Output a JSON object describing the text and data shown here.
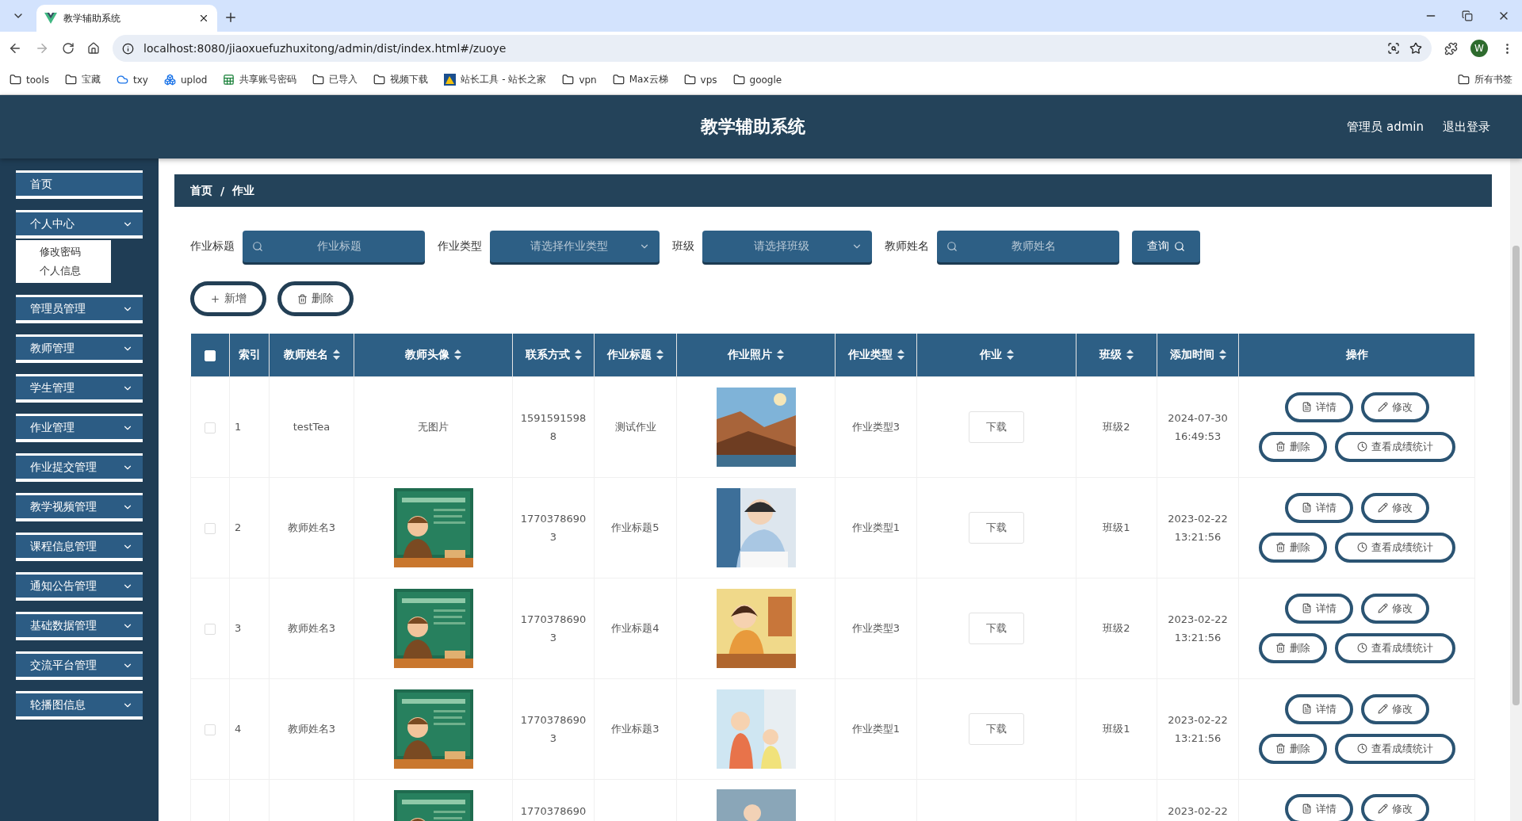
{
  "browser": {
    "tab_title": "教学辅助系统",
    "url": "localhost:8080/jiaoxuefuzhuxitong/admin/dist/index.html#/zuoye",
    "profile": "W",
    "bookmarks": [
      {
        "label": "tools",
        "kind": "folder"
      },
      {
        "label": "宝藏",
        "kind": "folder"
      },
      {
        "label": "txy",
        "kind": "cloud"
      },
      {
        "label": "uplod",
        "kind": "cluster"
      },
      {
        "label": "共享账号密码",
        "kind": "sheet"
      },
      {
        "label": "已导入",
        "kind": "folder"
      },
      {
        "label": "视频下载",
        "kind": "folder"
      },
      {
        "label": "站长工具 - 站长之家",
        "kind": "site"
      },
      {
        "label": "vpn",
        "kind": "folder"
      },
      {
        "label": "Max云梯",
        "kind": "folder"
      },
      {
        "label": "vps",
        "kind": "folder"
      },
      {
        "label": "google",
        "kind": "folder"
      }
    ],
    "all_bookmarks": "所有书签"
  },
  "header": {
    "title": "教学辅助系统",
    "user": "管理员 admin",
    "logout": "退出登录"
  },
  "sidebar": {
    "items": [
      {
        "label": "首页",
        "expandable": false
      },
      {
        "label": "个人中心",
        "expandable": true,
        "children": [
          {
            "label": "修改密码"
          },
          {
            "label": "个人信息"
          }
        ]
      },
      {
        "label": "管理员管理",
        "expandable": true
      },
      {
        "label": "教师管理",
        "expandable": true
      },
      {
        "label": "学生管理",
        "expandable": true
      },
      {
        "label": "作业管理",
        "expandable": true
      },
      {
        "label": "作业提交管理",
        "expandable": true
      },
      {
        "label": "教学视频管理",
        "expandable": true
      },
      {
        "label": "课程信息管理",
        "expandable": true
      },
      {
        "label": "通知公告管理",
        "expandable": true
      },
      {
        "label": "基础数据管理",
        "expandable": true
      },
      {
        "label": "交流平台管理",
        "expandable": true
      },
      {
        "label": "轮播图信息",
        "expandable": true
      }
    ]
  },
  "breadcrumb": {
    "items": [
      "首页",
      "作业"
    ],
    "separator": "/"
  },
  "filters": [
    {
      "label": "作业标题",
      "kind": "search",
      "placeholder": "作业标题"
    },
    {
      "label": "作业类型",
      "kind": "select",
      "placeholder": "请选择作业类型"
    },
    {
      "label": "班级",
      "kind": "select",
      "placeholder": "请选择班级"
    },
    {
      "label": "教师姓名",
      "kind": "search",
      "placeholder": "教师姓名"
    }
  ],
  "query_button": "查询",
  "actions": [
    {
      "label": "新增",
      "kind": "add"
    },
    {
      "label": "删除",
      "kind": "delete"
    }
  ],
  "table": {
    "select_all": {
      "checked": false
    },
    "columns": [
      {
        "label": "索引",
        "sortable": false
      },
      {
        "label": "教师姓名",
        "sortable": true
      },
      {
        "label": "教师头像",
        "sortable": true
      },
      {
        "label": "联系方式",
        "sortable": true
      },
      {
        "label": "作业标题",
        "sortable": true
      },
      {
        "label": "作业照片",
        "sortable": true
      },
      {
        "label": "作业类型",
        "sortable": true
      },
      {
        "label": "作业",
        "sortable": true
      },
      {
        "label": "班级",
        "sortable": true
      },
      {
        "label": "添加时间",
        "sortable": true
      },
      {
        "label": "操作",
        "sortable": false
      }
    ],
    "rows": [
      {
        "checked": false,
        "index": "1",
        "teacher": "testTea",
        "avatar": {
          "kind": "none",
          "text": "无图片"
        },
        "contact": "15915915988",
        "title": "测试作业",
        "photo": {
          "kind": "picture"
        },
        "type": "作业类型3",
        "file": "下载",
        "class": "班级2",
        "time": "2024-07-30 16:49:53",
        "operations": [
          {
            "label": "详情",
            "kind": "detail"
          },
          {
            "label": "修改",
            "kind": "edit"
          },
          {
            "label": "删除",
            "kind": "delete"
          },
          {
            "label": "查看成绩统计",
            "kind": "stats"
          }
        ]
      },
      {
        "checked": false,
        "index": "2",
        "teacher": "教师姓名3",
        "avatar": {
          "kind": "picture"
        },
        "contact": "17703786903",
        "title": "作业标题5",
        "photo": {
          "kind": "picture"
        },
        "type": "作业类型1",
        "file": "下载",
        "class": "班级1",
        "time": "2023-02-22 13:21:56",
        "operations": [
          {
            "label": "详情",
            "kind": "detail"
          },
          {
            "label": "修改",
            "kind": "edit"
          },
          {
            "label": "删除",
            "kind": "delete"
          },
          {
            "label": "查看成绩统计",
            "kind": "stats"
          }
        ]
      },
      {
        "checked": false,
        "index": "3",
        "teacher": "教师姓名3",
        "avatar": {
          "kind": "picture"
        },
        "contact": "17703786903",
        "title": "作业标题4",
        "photo": {
          "kind": "picture"
        },
        "type": "作业类型3",
        "file": "下载",
        "class": "班级2",
        "time": "2023-02-22 13:21:56",
        "operations": [
          {
            "label": "详情",
            "kind": "detail"
          },
          {
            "label": "修改",
            "kind": "edit"
          },
          {
            "label": "删除",
            "kind": "delete"
          },
          {
            "label": "查看成绩统计",
            "kind": "stats"
          }
        ]
      },
      {
        "checked": false,
        "index": "4",
        "teacher": "教师姓名3",
        "avatar": {
          "kind": "picture"
        },
        "contact": "17703786903",
        "title": "作业标题3",
        "photo": {
          "kind": "picture"
        },
        "type": "作业类型1",
        "file": "下载",
        "class": "班级1",
        "time": "2023-02-22 13:21:56",
        "operations": [
          {
            "label": "详情",
            "kind": "detail"
          },
          {
            "label": "修改",
            "kind": "edit"
          },
          {
            "label": "删除",
            "kind": "delete"
          },
          {
            "label": "查看成绩统计",
            "kind": "stats"
          }
        ]
      },
      {
        "avatar": {
          "kind": "picture"
        },
        "contact": "1770378690",
        "photo": {
          "kind": "picture"
        },
        "time": "2023-02-22",
        "operations": [
          {
            "label": "详情",
            "kind": "detail"
          },
          {
            "label": "修改",
            "kind": "edit"
          }
        ]
      }
    ]
  }
}
